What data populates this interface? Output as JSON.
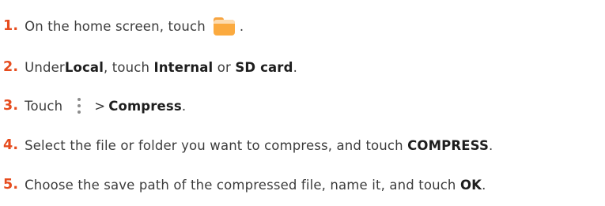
{
  "steps": [
    {
      "number": "1.",
      "text_before": "On the home screen, touch",
      "icon": "file-manager-folder-icon",
      "text_after": "."
    },
    {
      "number": "2.",
      "parts": [
        "Under ",
        "Local",
        ", touch ",
        "Internal",
        " or ",
        "SD card",
        "."
      ]
    },
    {
      "number": "3.",
      "text_before": "Touch",
      "icon": "more-vertical-icon",
      "separator": ">",
      "bold": "Compress",
      "text_after": "."
    },
    {
      "number": "4.",
      "text": "Select the file or folder you want to compress, and touch ",
      "bold": "COMPRESS",
      "text_after": "."
    },
    {
      "number": "5.",
      "text": "Choose the save path of the compressed file, name it, and touch ",
      "bold": "OK",
      "text_after": "."
    }
  ],
  "colors": {
    "step_number": "#e64c1e",
    "body_text": "#3c3c3c",
    "folder_icon": "#fbaa3f"
  }
}
